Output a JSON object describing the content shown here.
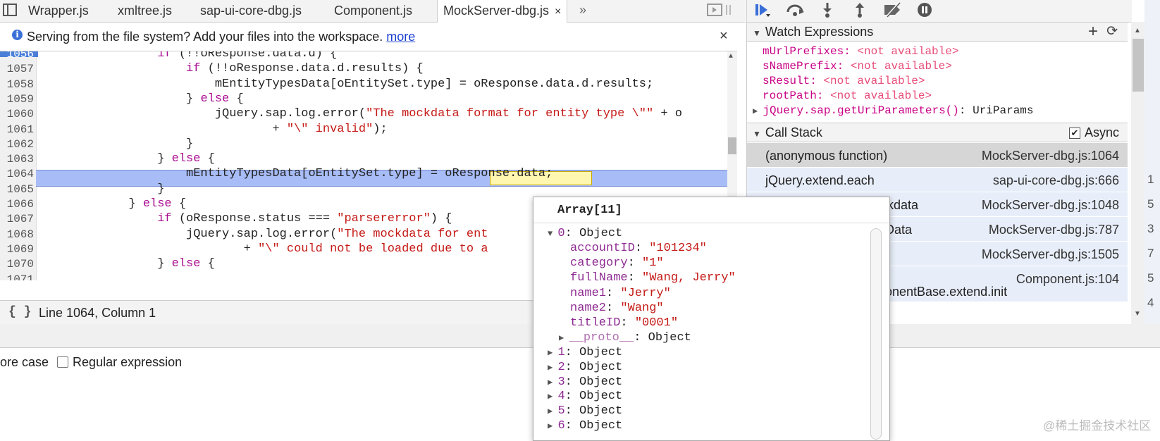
{
  "tabs": [
    {
      "label": "Wrapper.js"
    },
    {
      "label": "xmltree.js"
    },
    {
      "label": "sap-ui-core-dbg.js"
    },
    {
      "label": "Component.js"
    },
    {
      "label": "MockServer-dbg.js",
      "active": true,
      "close": "×"
    }
  ],
  "tabs_more": "»",
  "infobar": {
    "icon": "i",
    "text": "Serving from the file system? Add your files into the workspace.",
    "link": "more",
    "close": "×"
  },
  "editor": {
    "lines": [
      {
        "n": "1056",
        "code": "                if (!!oResponse.data.d) {"
      },
      {
        "n": "1057",
        "code": "                    if (!!oResponse.data.d.results) {"
      },
      {
        "n": "1058",
        "code": "                        mEntityTypesData[oEntitySet.type] = oResponse.data.d.results;"
      },
      {
        "n": "1059",
        "code": "                    } else {"
      },
      {
        "n": "1060",
        "code": "                        jQuery.sap.log.error(\"The mockdata format for entity type \\\"\" + o"
      },
      {
        "n": "1061",
        "code": "                                + \"\\\" invalid\");"
      },
      {
        "n": "1062",
        "code": "                    }"
      },
      {
        "n": "1063",
        "code": "                } else {"
      },
      {
        "n": "1064",
        "code": "                    mEntityTypesData[oEntitySet.type] = oResponse.data;"
      },
      {
        "n": "1065",
        "code": "                }"
      },
      {
        "n": "1066",
        "code": "            } else {"
      },
      {
        "n": "1067",
        "code": "                if (oResponse.status === \"parsererror\") {"
      },
      {
        "n": "1068",
        "code": "                    jQuery.sap.log.error(\"The mockdata for ent"
      },
      {
        "n": "1069",
        "code": "                            + \"\\\" could not be loaded due to a"
      },
      {
        "n": "1070",
        "code": "                } else {"
      },
      {
        "n": "1071",
        "code": ""
      }
    ]
  },
  "statusbar": {
    "pretty_print": "{ }",
    "cursor": "Line 1064, Column 1"
  },
  "search": {
    "ignore_case_label": "ore case",
    "regex_label": "Regular expression"
  },
  "watch": {
    "title": "Watch Expressions",
    "add": "+",
    "refresh": "⟳",
    "items": [
      {
        "name": "mUrlPrefixes",
        "value": "<not available>"
      },
      {
        "name": "sNamePrefix",
        "value": "<not available>"
      },
      {
        "name": "sResult",
        "value": "<not available>"
      },
      {
        "name": "rootPath",
        "value": "<not available>"
      }
    ],
    "expr": {
      "name": "jQuery.sap.getUriParameters()",
      "value": "UriParams"
    }
  },
  "callstack": {
    "title": "Call Stack",
    "async_label": "Async",
    "frames": [
      {
        "fn": "(anonymous function)",
        "loc": "MockServer-dbg.js:1064"
      },
      {
        "fn": "jQuery.extend.each",
        "loc": "sap-ui-core-dbg.js:666"
      },
      {
        "fn": "ckdata",
        "loc": "MockServer-dbg.js:1048"
      },
      {
        "fn": "Data",
        "loc": "MockServer-dbg.js:787"
      },
      {
        "fn": "",
        "loc": "MockServer-dbg.js:1505"
      },
      {
        "fn": "onentBase.extend.init",
        "loc": "Component.js:104"
      }
    ]
  },
  "side_digits": [
    "1",
    "5",
    "3",
    "7",
    "5",
    "4"
  ],
  "popover": {
    "title": "Array[11]",
    "expanded": {
      "key": "0",
      "type": "Object"
    },
    "props": [
      {
        "key": "accountID",
        "value": "\"101234\""
      },
      {
        "key": "category",
        "value": "\"1\""
      },
      {
        "key": "fullName",
        "value": "\"Wang, Jerry\""
      },
      {
        "key": "name1",
        "value": "\"Jerry\""
      },
      {
        "key": "name2",
        "value": "\"Wang\""
      },
      {
        "key": "titleID",
        "value": "\"0001\""
      }
    ],
    "proto": {
      "key": "__proto__",
      "type": "Object"
    },
    "collapsed": [
      {
        "key": "1",
        "type": "Object"
      },
      {
        "key": "2",
        "type": "Object"
      },
      {
        "key": "3",
        "type": "Object"
      },
      {
        "key": "4",
        "type": "Object"
      },
      {
        "key": "5",
        "type": "Object"
      },
      {
        "key": "6",
        "type": "Object"
      }
    ]
  },
  "watermark": "@稀土掘金技术社区"
}
